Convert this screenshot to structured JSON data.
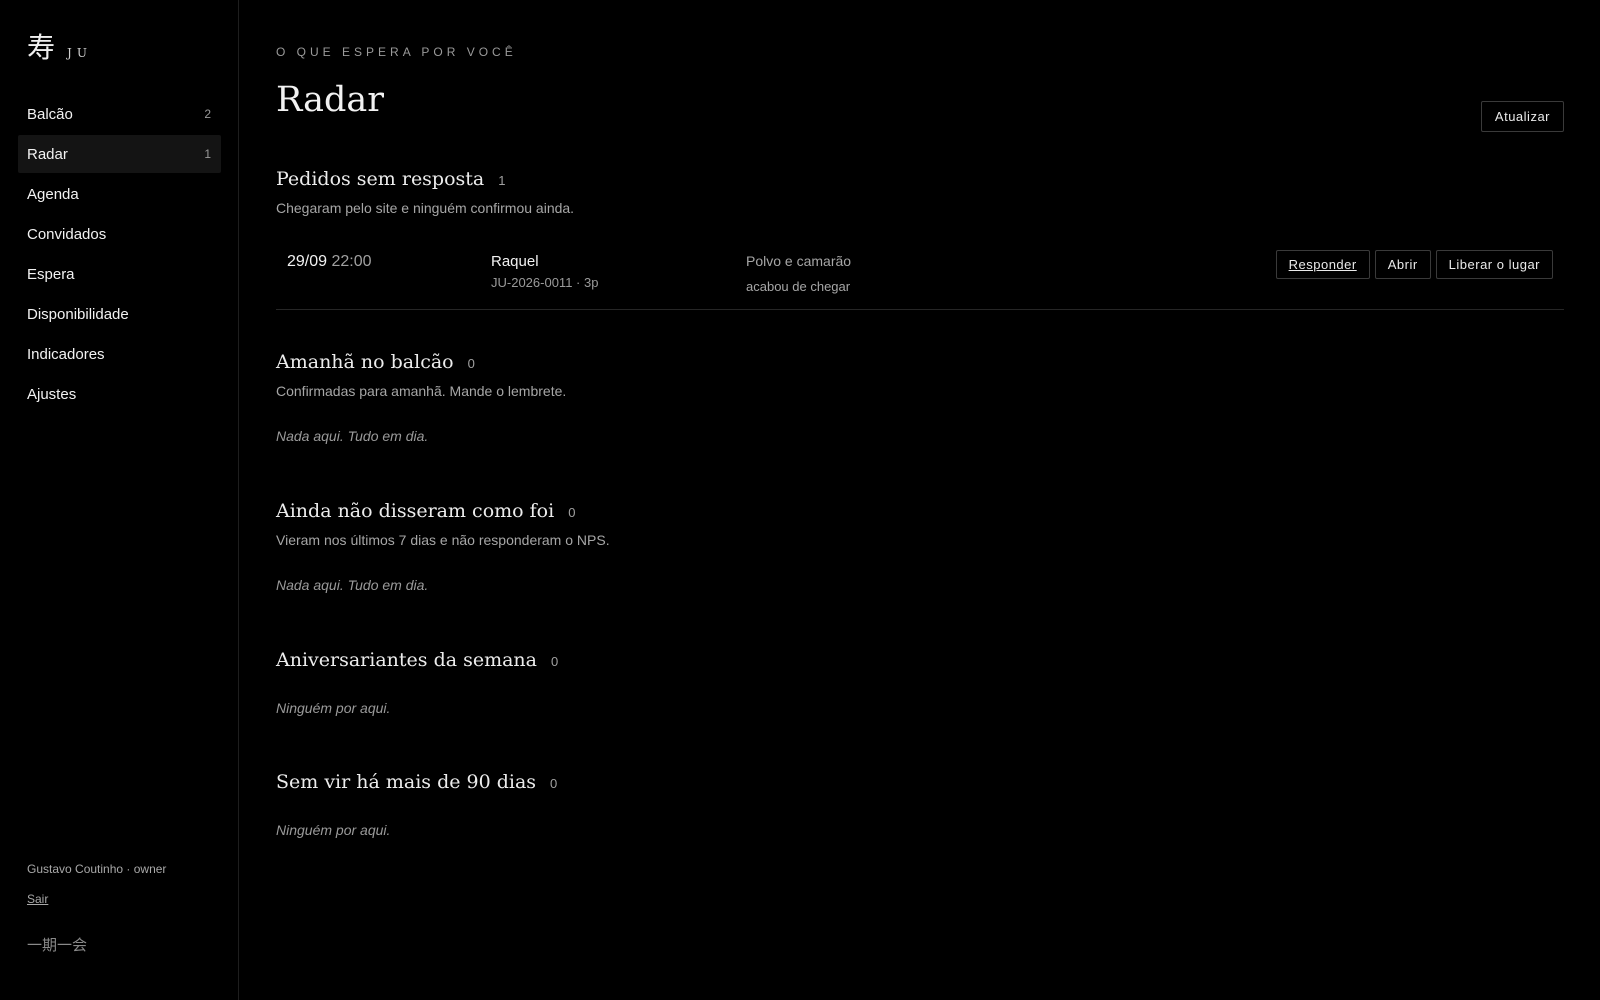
{
  "brand": {
    "mark": "寿",
    "name": "JU"
  },
  "nav": [
    {
      "label": "Balcão",
      "count": "2",
      "active": false
    },
    {
      "label": "Radar",
      "count": "1",
      "active": true
    },
    {
      "label": "Agenda",
      "count": "",
      "active": false
    },
    {
      "label": "Convidados",
      "count": "",
      "active": false
    },
    {
      "label": "Espera",
      "count": "",
      "active": false
    },
    {
      "label": "Disponibilidade",
      "count": "",
      "active": false
    },
    {
      "label": "Indicadores",
      "count": "",
      "active": false
    },
    {
      "label": "Ajustes",
      "count": "",
      "active": false
    }
  ],
  "footer": {
    "user": "Gustavo Coutinho · owner",
    "logout": "Sair",
    "motto": "一期一会"
  },
  "header": {
    "eyebrow": "O QUE ESPERA POR VOCÊ",
    "title": "Radar",
    "refresh_label": "Atualizar"
  },
  "sections": {
    "pending": {
      "title": "Pedidos sem resposta",
      "count": "1",
      "subtitle": "Chegaram pelo site e ninguém confirmou ainda.",
      "rows": [
        {
          "date": "29/09",
          "time": "22:00",
          "guest": "Raquel",
          "ref": "JU-2026-0011 · 3p",
          "dish": "Polvo e camarão",
          "status": "acabou de chegar",
          "actions": {
            "reply": "Responder",
            "open": "Abrir",
            "release": "Liberar o lugar"
          }
        }
      ]
    },
    "tomorrow": {
      "title": "Amanhã no balcão",
      "count": "0",
      "subtitle": "Confirmadas para amanhã. Mande o lembrete.",
      "empty": "Nada aqui. Tudo em dia."
    },
    "nps": {
      "title": "Ainda não disseram como foi",
      "count": "0",
      "subtitle": "Vieram nos últimos 7 dias e não responderam o NPS.",
      "empty": "Nada aqui. Tudo em dia."
    },
    "birthdays": {
      "title": "Aniversariantes da semana",
      "count": "0",
      "empty": "Ninguém por aqui."
    },
    "lapsed": {
      "title": "Sem vir há mais de 90 dias",
      "count": "0",
      "empty": "Ninguém por aqui."
    }
  }
}
